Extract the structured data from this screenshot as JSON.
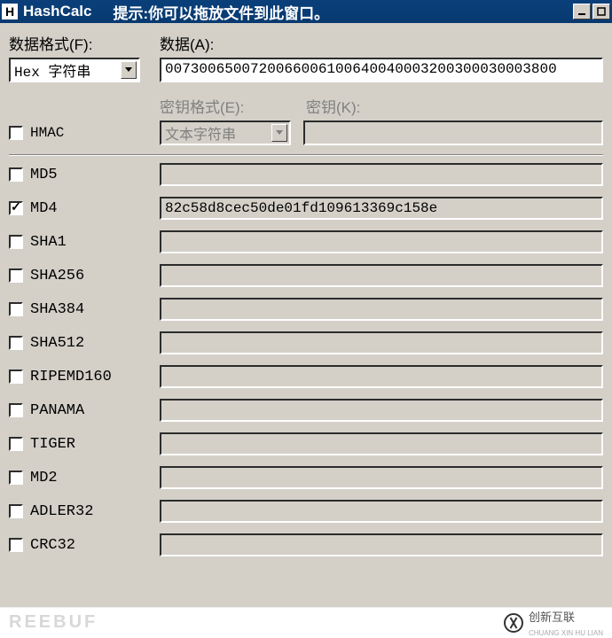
{
  "title": {
    "icon_letter": "H",
    "app_name": "HashCalc",
    "hint": "提示:你可以拖放文件到此窗口。"
  },
  "top": {
    "data_format_label": "数据格式(F):",
    "data_label": "数据(A):",
    "data_format_value": "Hex 字符串",
    "data_value": "0073006500720066006100640040003200300030003800",
    "key_format_label": "密钥格式(E):",
    "key_label": "密钥(K):",
    "key_format_value": "文本字符串",
    "key_value": "",
    "hmac_label": "HMAC",
    "hmac_checked": false
  },
  "hashes": [
    {
      "name": "MD5",
      "checked": false,
      "value": ""
    },
    {
      "name": "MD4",
      "checked": true,
      "value": "82c58d8cec50de01fd109613369c158e"
    },
    {
      "name": "SHA1",
      "checked": false,
      "value": ""
    },
    {
      "name": "SHA256",
      "checked": false,
      "value": ""
    },
    {
      "name": "SHA384",
      "checked": false,
      "value": ""
    },
    {
      "name": "SHA512",
      "checked": false,
      "value": ""
    },
    {
      "name": "RIPEMD160",
      "checked": false,
      "value": ""
    },
    {
      "name": "PANAMA",
      "checked": false,
      "value": ""
    },
    {
      "name": "TIGER",
      "checked": false,
      "value": ""
    },
    {
      "name": "MD2",
      "checked": false,
      "value": ""
    },
    {
      "name": "ADLER32",
      "checked": false,
      "value": ""
    },
    {
      "name": "CRC32",
      "checked": false,
      "value": ""
    }
  ],
  "watermarks": {
    "left": "REEBUF",
    "right_text": "创新互联",
    "right_sub": "CHUANG XIN HU LIAN"
  }
}
